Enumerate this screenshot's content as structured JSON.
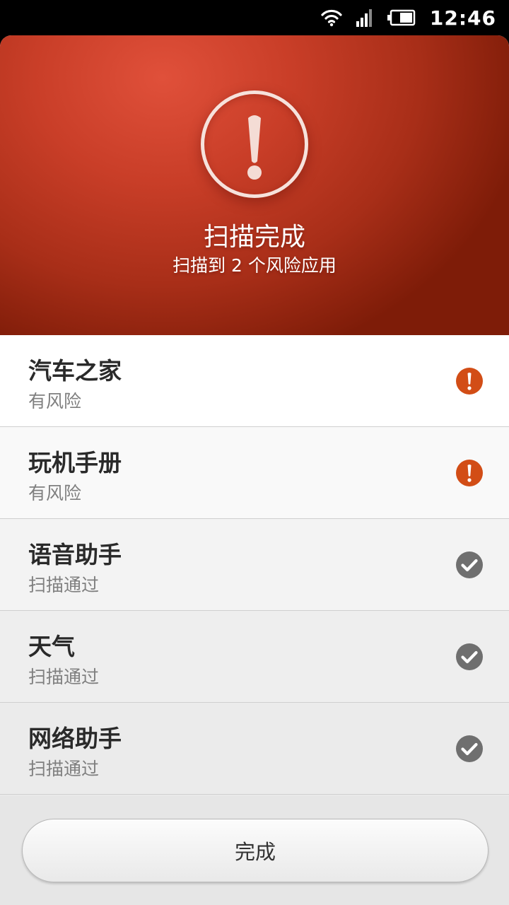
{
  "status_bar": {
    "time": "12:46",
    "icons": [
      "wifi-icon",
      "signal-icon",
      "battery-icon"
    ]
  },
  "header": {
    "title": "扫描完成",
    "subtitle": "扫描到 2 个风险应用",
    "icon": "warning-icon"
  },
  "apps": [
    {
      "name": "汽车之家",
      "status": "有风险",
      "icon": "risk-icon"
    },
    {
      "name": "玩机手册",
      "status": "有风险",
      "icon": "risk-icon"
    },
    {
      "name": "语音助手",
      "status": "扫描通过",
      "icon": "check-icon"
    },
    {
      "name": "天气",
      "status": "扫描通过",
      "icon": "check-icon"
    },
    {
      "name": "网络助手",
      "status": "扫描通过",
      "icon": "check-icon"
    }
  ],
  "footer": {
    "done_label": "完成"
  },
  "colors": {
    "header_red": "#c93e28",
    "risk_orange": "#d24d16",
    "pass_gray": "#6f6f6f"
  }
}
